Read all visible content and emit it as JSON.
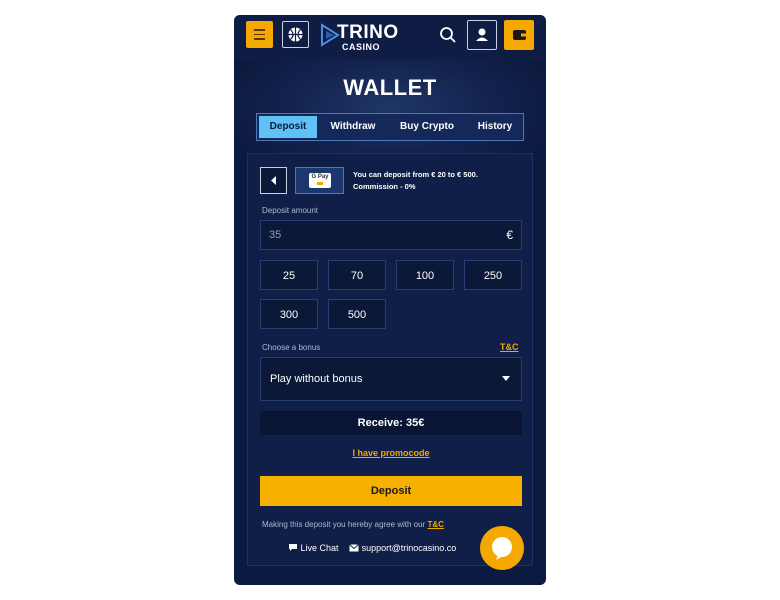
{
  "header": {
    "logo_line1": "TRINO",
    "logo_line2": "CASINO"
  },
  "wallet": {
    "title": "WALLET",
    "tabs": [
      {
        "label": "Deposit",
        "active": true
      },
      {
        "label": "Withdraw",
        "active": false
      },
      {
        "label": "Buy Crypto",
        "active": false
      },
      {
        "label": "History",
        "active": false
      }
    ]
  },
  "payment": {
    "method_badge": "G Pay",
    "info_line1": "You can deposit from € 20 to € 500.",
    "info_line2": "Commission - 0%"
  },
  "deposit": {
    "amount_label": "Deposit amount",
    "amount_value": "35",
    "currency_symbol": "€",
    "quick_amounts": [
      "25",
      "70",
      "100",
      "250",
      "300",
      "500"
    ]
  },
  "bonus": {
    "label": "Choose a bonus",
    "tc_link": "T&C",
    "selected": "Play without bonus"
  },
  "summary": {
    "receive_text": "Receive: 35€",
    "promo_link": "I have promocode",
    "deposit_button": "Deposit",
    "agree_text": "Making this deposit you hereby agree with our",
    "agree_link": "T&C"
  },
  "support": {
    "live_chat": "Live Chat",
    "email": "support@trinocasino.co"
  },
  "colors": {
    "accent": "#f5a800",
    "background": "#0d1a3f",
    "active_tab": "#5fc1f5"
  }
}
